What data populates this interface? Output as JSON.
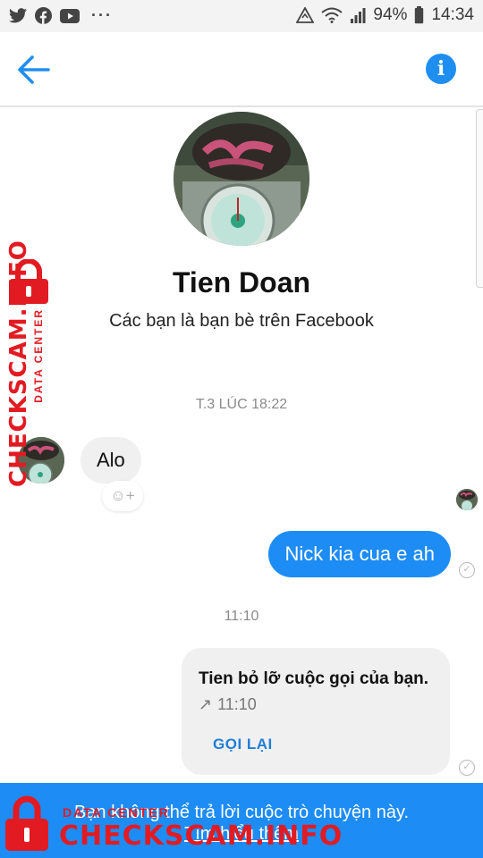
{
  "status_bar": {
    "battery": "94%",
    "time": "14:34",
    "more_indicator": "···",
    "icons_left": [
      "twitter-icon",
      "facebook-icon",
      "youtube-icon"
    ],
    "icons_right": [
      "data-saver-icon",
      "wifi-icon",
      "signal-icon"
    ]
  },
  "toolbar": {
    "back_icon": "arrow-left-icon",
    "info_icon": "info-icon",
    "accent": "#1f8ef1"
  },
  "profile": {
    "name": "Tien Doan",
    "subtitle": "Các bạn là bạn bè trên Facebook"
  },
  "messages": {
    "timestamp_1": "T.3 LÚC 18:22",
    "incoming_text": "Alo",
    "reaction_label": "☺+",
    "outgoing_text": "Nick kia cua e ah",
    "timestamp_2": "11:10",
    "call_card": {
      "title": "Tien bỏ lỡ cuộc gọi của bạn.",
      "time": "11:10",
      "arrow": "↗",
      "call_back": "GỌI LẠI"
    },
    "outgoing_color": "#1d8cf5",
    "incoming_color": "#f0f0f0"
  },
  "banner": {
    "text": "Bạn không thể trả lời cuộc trò chuyện này.",
    "link": "Tìm hiểu thêm"
  },
  "watermark": {
    "brand": "CHECKSCAM.INFO",
    "tag": "DATA CENTER",
    "color": "#e21b22"
  }
}
